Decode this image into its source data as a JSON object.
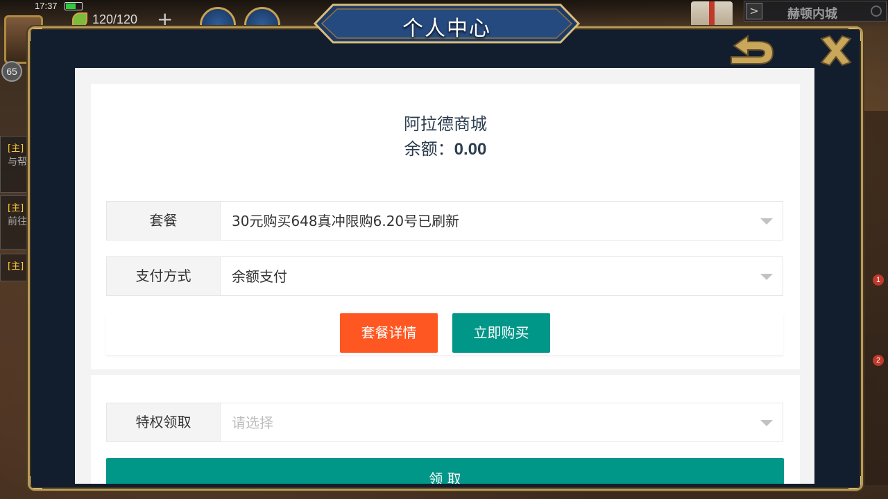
{
  "status_bar": {
    "time": "17:37"
  },
  "hud": {
    "stamina": "120/120",
    "plus": "+",
    "level": "65",
    "map_name": "赫顿内城",
    "map_toggle": ">",
    "quests": [
      {
        "tag": "[主]",
        "text": "与帮"
      },
      {
        "tag": "[主]",
        "text": "前往"
      },
      {
        "tag": "[主]",
        "text": ""
      }
    ],
    "badges": [
      "1",
      "2"
    ]
  },
  "modal": {
    "title": "个人中心"
  },
  "shop": {
    "name": "阿拉德商城",
    "balance_label": "余额：",
    "balance_value": "0.00"
  },
  "form": {
    "package": {
      "label": "套餐",
      "value": "30元购买648真冲限购6.20号已刷新"
    },
    "payment": {
      "label": "支付方式",
      "value": "余额支付"
    },
    "detail_button": "套餐详情",
    "buy_button": "立即购买"
  },
  "privilege": {
    "label": "特权领取",
    "placeholder": "请选择",
    "claim_button": "领 取"
  },
  "colors": {
    "frame_gold": "#b89a5a",
    "modal_bg": "#121d2e",
    "detail_orange": "#ff5722",
    "buy_teal": "#009688",
    "text_dark": "#2c3e50"
  }
}
